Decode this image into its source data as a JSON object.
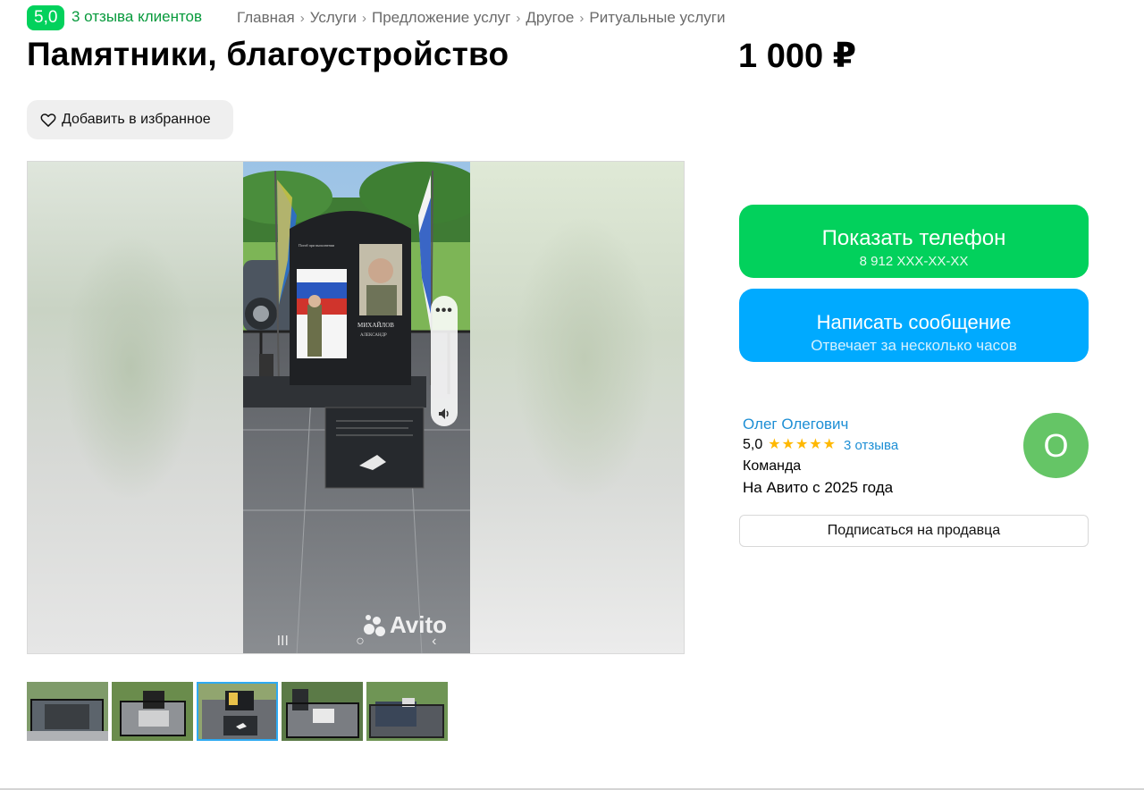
{
  "header": {
    "rating_badge": "5,0",
    "reviews_link": "3 отзыва клиентов",
    "breadcrumb": [
      "Главная",
      "Услуги",
      "Предложение услуг",
      "Другое",
      "Ритуальные услуги"
    ],
    "title": "Памятники, благоустройство",
    "price": "1 000 ₽"
  },
  "favorite": {
    "label": "Добавить в избранное",
    "icon": "heart-icon"
  },
  "gallery": {
    "watermark": "Avito",
    "thumbnail_count": 5,
    "active_thumbnail": 3,
    "more_icon": "more-dots-icon",
    "volume_icon": "volume-icon"
  },
  "contact": {
    "phone_button": "Показать телефон",
    "phone_masked": "8 912 XXX-XX-XX",
    "message_button": "Написать сообщение",
    "message_sub": "Отвечает за несколько часов"
  },
  "seller": {
    "name": "Олег Олегович",
    "rating": "5,0",
    "stars": 5,
    "reviews": "3 отзыва",
    "type": "Команда",
    "since": "На Авито с 2025 года",
    "avatar_letter": "О",
    "subscribe_button": "Подписаться на продавца"
  },
  "colors": {
    "green": "#02d15c",
    "blue": "#00aaff",
    "link": "#1e8fd5",
    "star": "#ffb800",
    "avatar": "#65c566"
  }
}
